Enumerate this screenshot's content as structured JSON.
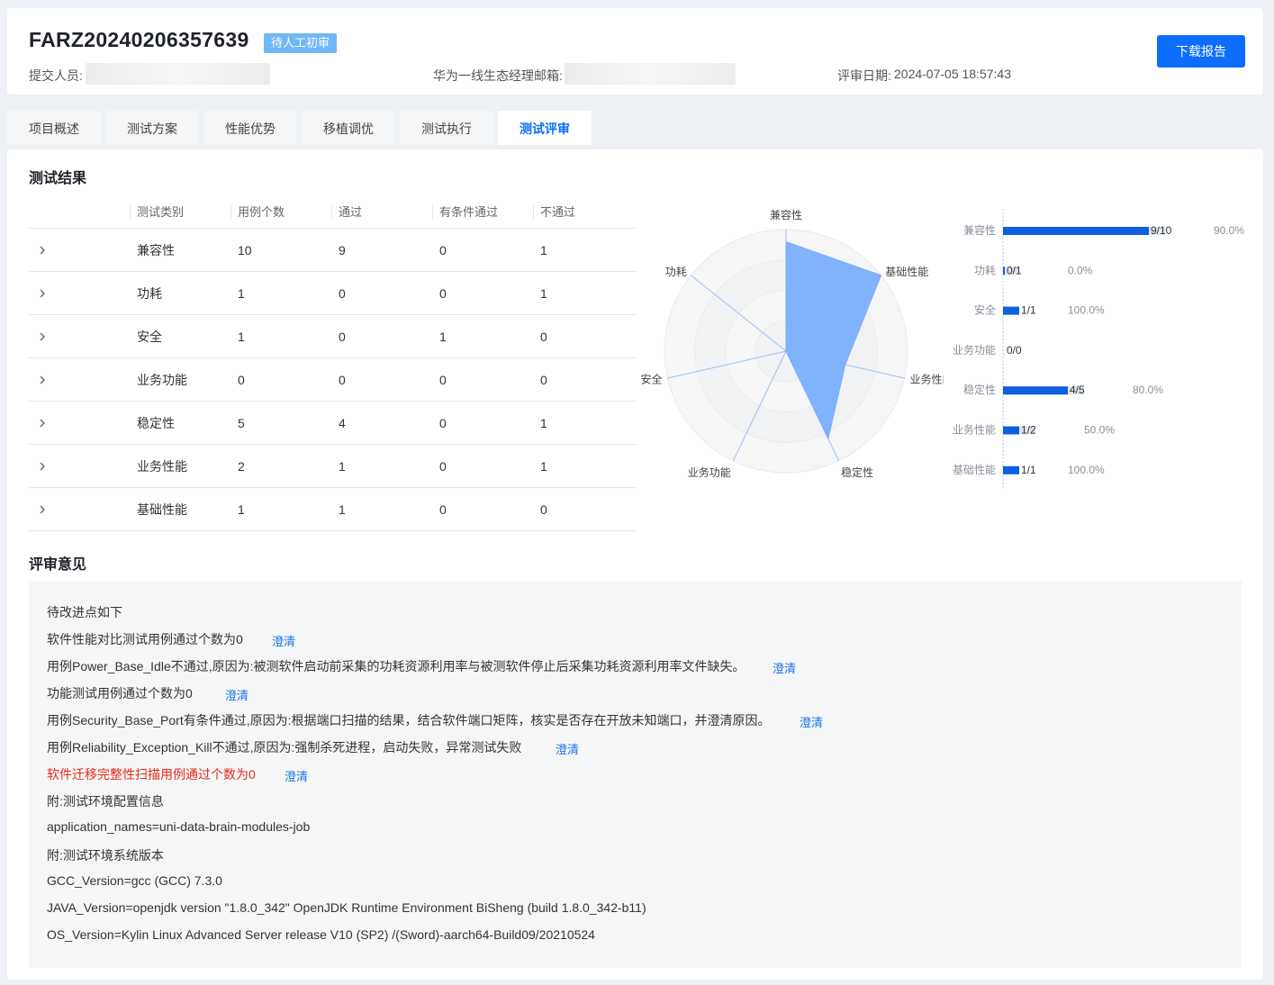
{
  "header": {
    "project_id": "FARZ20240206357639",
    "status": "待人工初审",
    "submitter_label": "提交人员:",
    "manager_email_label": "华为一线生态经理邮箱:",
    "review_date_label": "评审日期:",
    "review_date": "2024-07-05 18:57:43",
    "download_label": "下载报告"
  },
  "tabs": [
    {
      "label": "项目概述"
    },
    {
      "label": "测试方案"
    },
    {
      "label": "性能优势"
    },
    {
      "label": "移植调优"
    },
    {
      "label": "测试执行"
    },
    {
      "label": "测试评审",
      "active": true
    }
  ],
  "results": {
    "title": "测试结果",
    "columns": [
      "测试类别",
      "用例个数",
      "通过",
      "有条件通过",
      "不通过"
    ],
    "rows": [
      {
        "category": "兼容性",
        "total": "10",
        "pass": "9",
        "conditional": "0",
        "fail": "1"
      },
      {
        "category": "功耗",
        "total": "1",
        "pass": "0",
        "conditional": "0",
        "fail": "1"
      },
      {
        "category": "安全",
        "total": "1",
        "pass": "0",
        "conditional": "1",
        "fail": "0"
      },
      {
        "category": "业务功能",
        "total": "0",
        "pass": "0",
        "conditional": "0",
        "fail": "0"
      },
      {
        "category": "稳定性",
        "total": "5",
        "pass": "4",
        "conditional": "0",
        "fail": "1"
      },
      {
        "category": "业务性能",
        "total": "2",
        "pass": "1",
        "conditional": "0",
        "fail": "1"
      },
      {
        "category": "基础性能",
        "total": "1",
        "pass": "1",
        "conditional": "0",
        "fail": "0"
      }
    ]
  },
  "chart_data": [
    {
      "type": "radar",
      "axes": [
        "兼容性",
        "基础性能",
        "业务性能",
        "稳定性",
        "业务功能",
        "安全",
        "功耗"
      ],
      "values": [
        0.9,
        1.0,
        0.5,
        0.8,
        0.0,
        0.0,
        0.0
      ],
      "range": [
        0,
        1
      ],
      "color": "#7aaefc"
    },
    {
      "type": "bar",
      "orientation": "horizontal",
      "categories": [
        "兼容性",
        "功耗",
        "安全",
        "业务功能",
        "稳定性",
        "业务性能",
        "基础性能"
      ],
      "passed": [
        9,
        0,
        1,
        0,
        4,
        1,
        1
      ],
      "totals": [
        10,
        1,
        1,
        0,
        5,
        2,
        1
      ],
      "value_labels": [
        "9/10",
        "0/1",
        "1/1",
        "0/0",
        "4/5",
        "1/2",
        "1/1"
      ],
      "percent_labels": [
        "90.0%",
        "0.0%",
        "100.0%",
        "",
        "80.0%",
        "50.0%",
        "100.0%"
      ],
      "bar_color": "#0d5fe0",
      "track_color": "#dde4ef"
    }
  ],
  "review": {
    "title": "评审意见",
    "clarify_label": "澄清",
    "lines": [
      {
        "text": "待改进点如下",
        "clarify": false,
        "red": false
      },
      {
        "text": "软件性能对比测试用例通过个数为0",
        "clarify": true,
        "red": false
      },
      {
        "text": "用例Power_Base_Idle不通过,原因为:被测软件启动前采集的功耗资源利用率与被测软件停止后采集功耗资源利用率文件缺失。",
        "clarify": true,
        "red": false
      },
      {
        "text": "功能测试用例通过个数为0",
        "clarify": true,
        "red": false
      },
      {
        "text": "用例Security_Base_Port有条件通过,原因为:根据端口扫描的结果，结合软件端口矩阵，核实是否存在开放未知端口，并澄清原因。",
        "clarify": true,
        "red": false
      },
      {
        "text": "用例Reliability_Exception_Kill不通过,原因为:强制杀死进程，启动失败，异常测试失败",
        "clarify": true,
        "red": false
      },
      {
        "text": "软件迁移完整性扫描用例通过个数为0",
        "clarify": true,
        "red": true
      },
      {
        "text": "附:测试环境配置信息",
        "clarify": false,
        "red": false
      },
      {
        "text": "application_names=uni-data-brain-modules-job",
        "clarify": false,
        "red": false
      },
      {
        "text": "附:测试环境系统版本",
        "clarify": false,
        "red": false
      },
      {
        "text": "GCC_Version=gcc (GCC) 7.3.0",
        "clarify": false,
        "red": false
      },
      {
        "text": "JAVA_Version=openjdk version \"1.8.0_342\" OpenJDK Runtime Environment BiSheng (build 1.8.0_342-b11)",
        "clarify": false,
        "red": false
      },
      {
        "text": "OS_Version=Kylin Linux Advanced Server release V10 (SP2) /(Sword)-aarch64-Build09/20210524",
        "clarify": false,
        "red": false
      }
    ]
  }
}
